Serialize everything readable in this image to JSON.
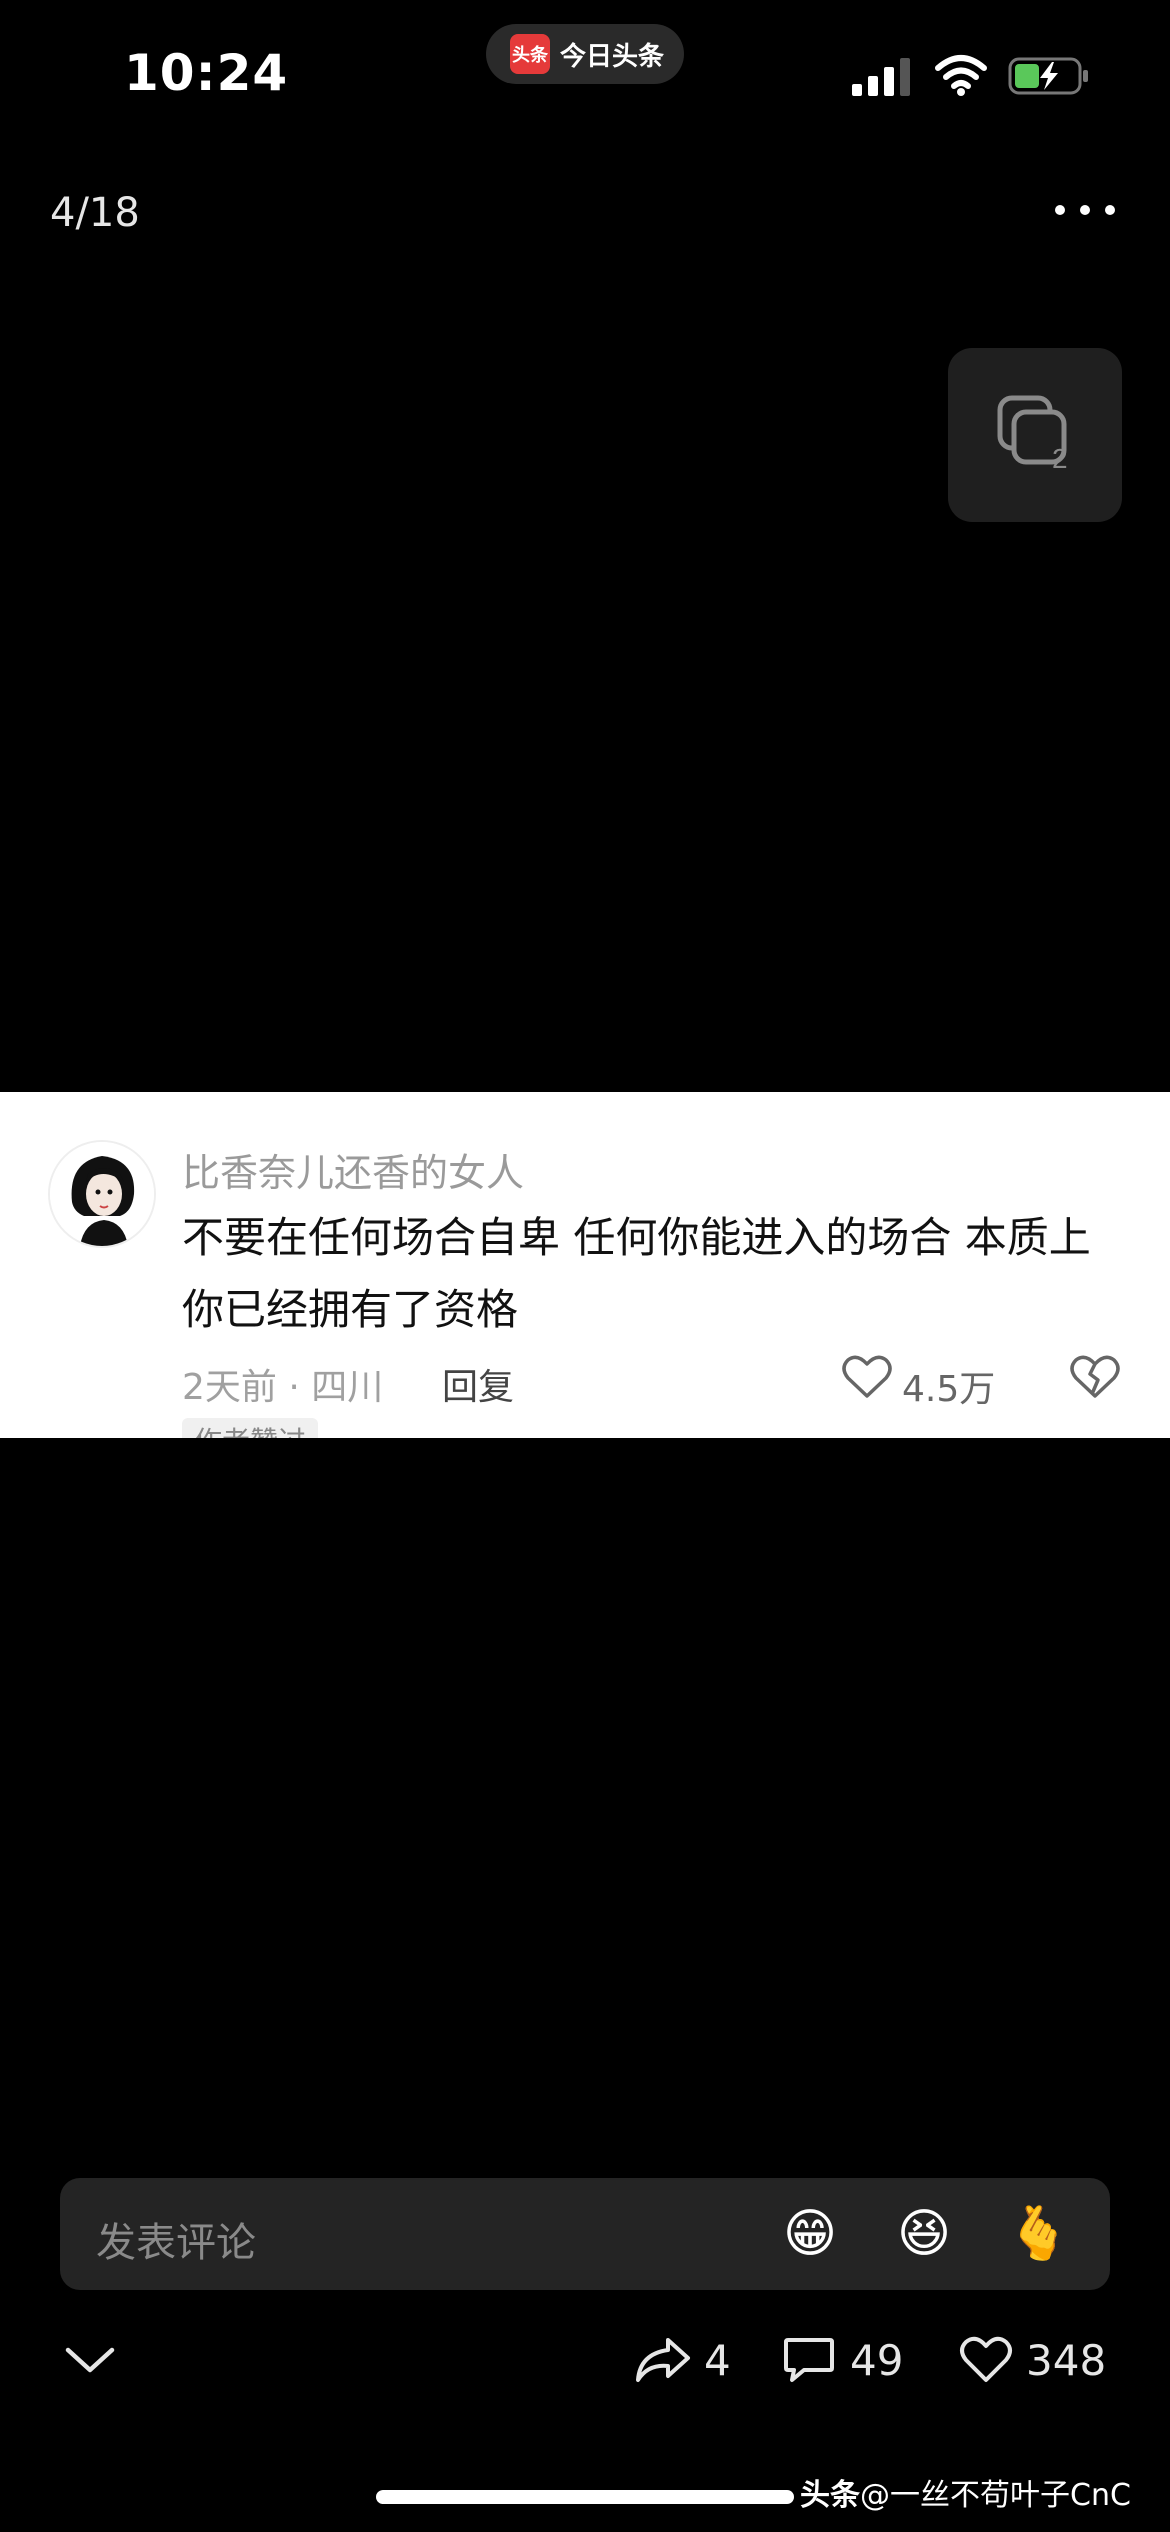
{
  "status_bar": {
    "time": "10:24",
    "app_pill": {
      "logo_text": "头条",
      "label": "今日头条"
    }
  },
  "top_bar": {
    "page_counter": "4/18",
    "gallery_count": "2"
  },
  "comment": {
    "username": "比香奈儿还香的女人",
    "text": "不要在任何场合自卑 任何你能进入的场合 本质上 你已经拥有了资格",
    "meta": "2天前 · 四川",
    "reply_label": "回复",
    "like_count": "4.5万",
    "badge": "作者赞过"
  },
  "comment_bar": {
    "placeholder": "发表评论",
    "emojis": [
      "😁",
      "😆",
      "🫰"
    ]
  },
  "bottom_actions": {
    "share_count": "4",
    "comment_count": "49",
    "like_count": "348"
  },
  "watermark": {
    "brand": "头条",
    "handle": "@一丝不苟叶子CnC"
  },
  "colors": {
    "background": "#000000",
    "card": "#ffffff",
    "logo_red": "#e53a3a",
    "battery_green": "#5ac85a"
  }
}
